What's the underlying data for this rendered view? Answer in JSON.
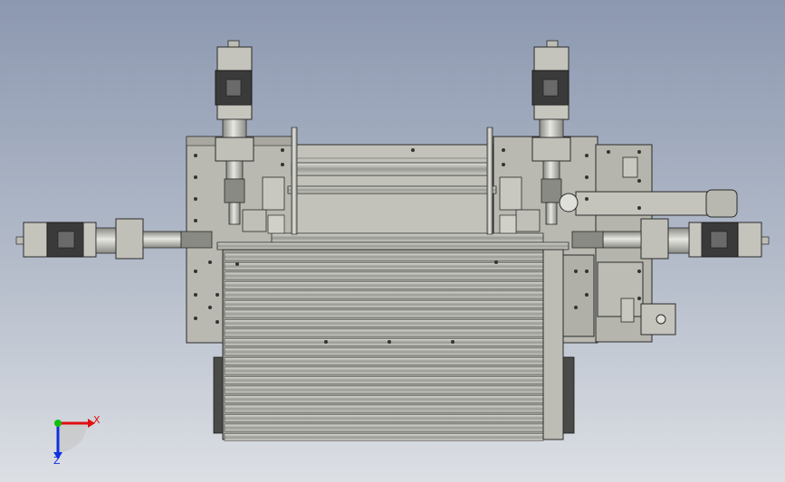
{
  "viewport": {
    "background_top": "#8c98b0",
    "background_bottom": "#dcdfe4"
  },
  "model": {
    "part_color": "#b8b8b0",
    "edge_color": "#2a2a2a",
    "motor_color": "#3a3a3a",
    "hole_color": "#333333"
  },
  "triad": {
    "x_label": "X",
    "z_label": "Z",
    "x_color": "#e01010",
    "y_color": "#10c010",
    "z_color": "#1030e0"
  }
}
